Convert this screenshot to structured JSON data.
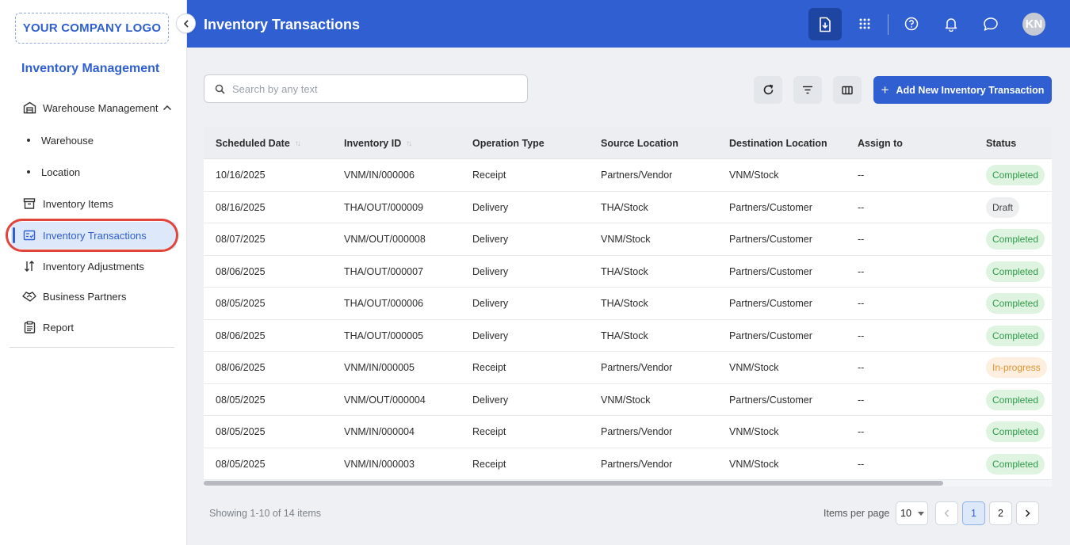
{
  "sidebar": {
    "logo_text": "YOUR COMPANY LOGO",
    "title": "Inventory Management",
    "items": [
      {
        "label": "Warehouse Management"
      },
      {
        "label": "Warehouse"
      },
      {
        "label": "Location"
      },
      {
        "label": "Inventory Items"
      },
      {
        "label": "Inventory Transactions"
      },
      {
        "label": "Inventory Adjustments"
      },
      {
        "label": "Business Partners"
      },
      {
        "label": "Report"
      }
    ]
  },
  "header": {
    "title": "Inventory Transactions",
    "avatar_initials": "KN",
    "icons": [
      "download-icon",
      "apps-grid-icon",
      "help-icon",
      "bell-icon",
      "chat-icon"
    ],
    "accent": "#2f5fd0"
  },
  "toolbar": {
    "search_placeholder": "Search by any text",
    "add_button_label": "Add New Inventory Transaction"
  },
  "table": {
    "columns": [
      "Scheduled Date",
      "Inventory ID",
      "Operation Type",
      "Source Location",
      "Destination Location",
      "Assign to",
      "Status"
    ],
    "rows": [
      [
        "10/16/2025",
        "VNM/IN/000006",
        "Receipt",
        "Partners/Vendor",
        "VNM/Stock",
        "--",
        "Completed"
      ],
      [
        "08/16/2025",
        "THA/OUT/000009",
        "Delivery",
        "THA/Stock",
        "Partners/Customer",
        "--",
        "Draft"
      ],
      [
        "08/07/2025",
        "VNM/OUT/000008",
        "Delivery",
        "VNM/Stock",
        "Partners/Customer",
        "--",
        "Completed"
      ],
      [
        "08/06/2025",
        "THA/OUT/000007",
        "Delivery",
        "THA/Stock",
        "Partners/Customer",
        "--",
        "Completed"
      ],
      [
        "08/05/2025",
        "THA/OUT/000006",
        "Delivery",
        "THA/Stock",
        "Partners/Customer",
        "--",
        "Completed"
      ],
      [
        "08/06/2025",
        "THA/OUT/000005",
        "Delivery",
        "THA/Stock",
        "Partners/Customer",
        "--",
        "Completed"
      ],
      [
        "08/06/2025",
        "VNM/IN/000005",
        "Receipt",
        "Partners/Vendor",
        "VNM/Stock",
        "--",
        "In-progress"
      ],
      [
        "08/05/2025",
        "VNM/OUT/000004",
        "Delivery",
        "VNM/Stock",
        "Partners/Customer",
        "--",
        "Completed"
      ],
      [
        "08/05/2025",
        "VNM/IN/000004",
        "Receipt",
        "Partners/Vendor",
        "VNM/Stock",
        "--",
        "Completed"
      ],
      [
        "08/05/2025",
        "VNM/IN/000003",
        "Receipt",
        "Partners/Vendor",
        "VNM/Stock",
        "--",
        "Completed"
      ]
    ]
  },
  "footer": {
    "showing_text": "Showing 1-10 of 14 items",
    "items_per_page_label": "Items per page",
    "items_per_page_value": "10",
    "pages": [
      "1",
      "2"
    ],
    "current_page": "1"
  }
}
